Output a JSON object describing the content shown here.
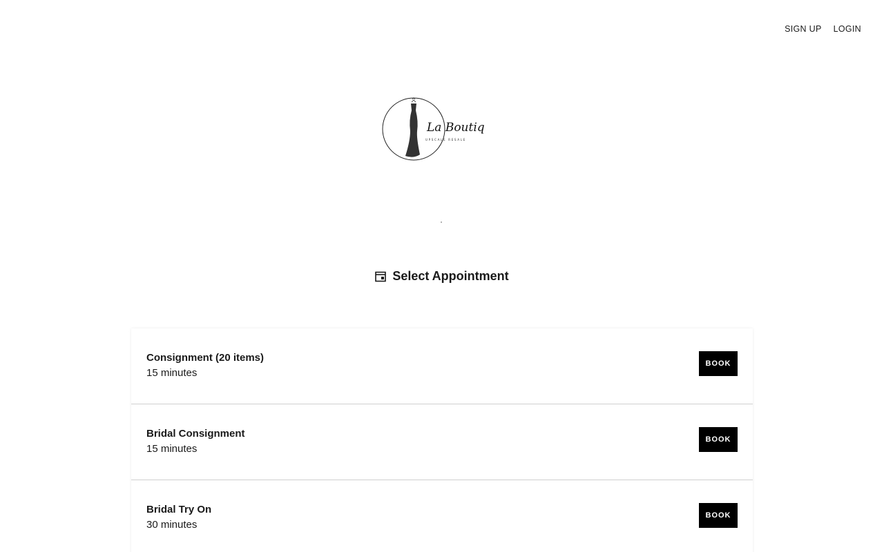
{
  "nav": {
    "signup_label": "SIGN UP",
    "login_label": "LOGIN"
  },
  "logo": {
    "title": "La Boutique",
    "subtitle": "UPSCALE RESALE"
  },
  "section": {
    "title": "Select Appointment",
    "icon": "calendar-icon"
  },
  "appointments": [
    {
      "name": "Consignment (20 items)",
      "duration": "15 minutes",
      "button": "BOOK"
    },
    {
      "name": "Bridal Consignment",
      "duration": "15 minutes",
      "button": "BOOK"
    },
    {
      "name": "Bridal Try On",
      "duration": "30 minutes",
      "button": "BOOK"
    }
  ],
  "colors": {
    "button_bg": "#000000",
    "button_text": "#ffffff",
    "divider": "#cfcfcf"
  }
}
